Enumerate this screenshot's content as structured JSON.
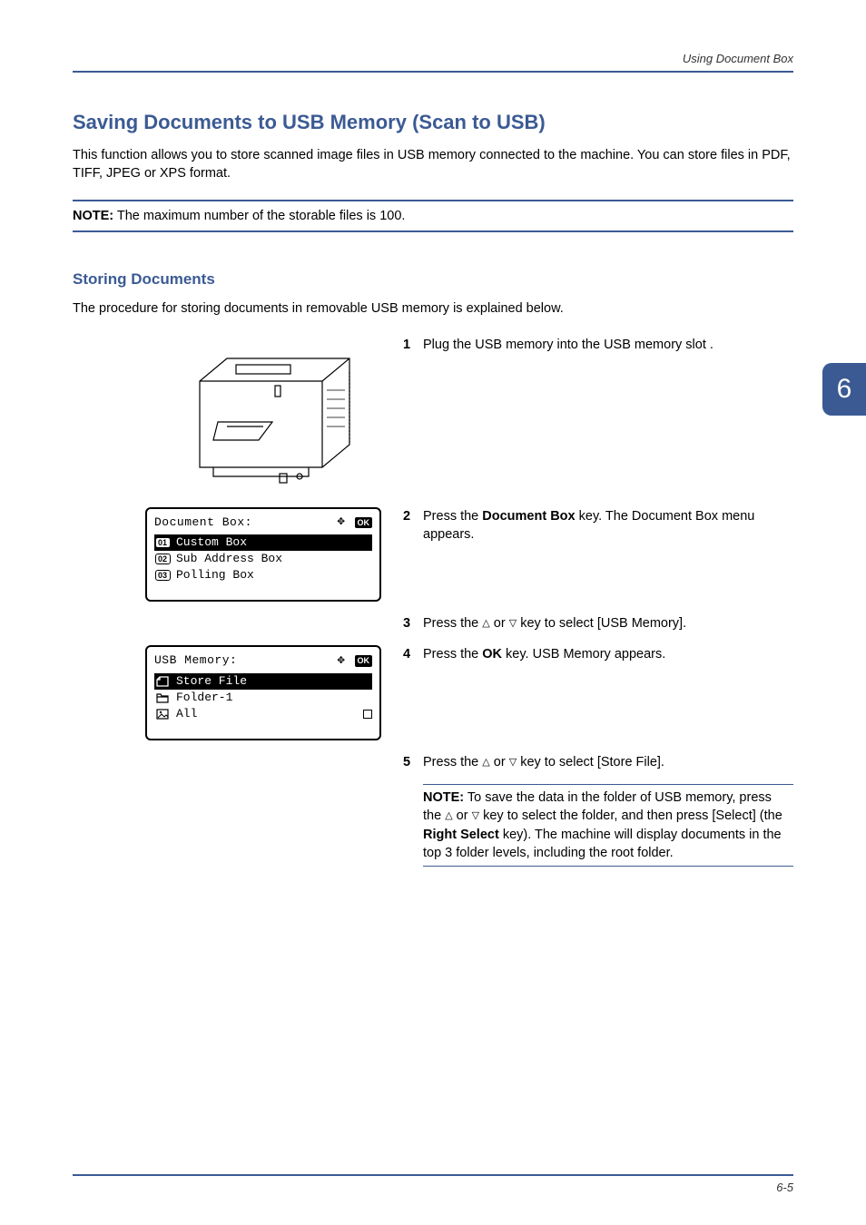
{
  "header": {
    "breadcrumb": "Using Document Box"
  },
  "title": "Saving Documents to USB Memory (Scan to USB)",
  "intro": "This function allows you to store scanned image files in USB memory connected to the machine. You can store files in PDF, TIFF, JPEG or XPS format.",
  "note": {
    "label": "NOTE:",
    "text": "The maximum number of the storable files is 100."
  },
  "subTitle": "Storing Documents",
  "procedureIntro": "The procedure for storing documents in removable USB memory is explained below.",
  "steps": {
    "s1": {
      "num": "1",
      "text": "Plug the USB memory into the USB memory slot ."
    },
    "s2": {
      "num": "2",
      "pre": "Press the ",
      "key": "Document Box",
      "post": " key. The Document Box menu appears."
    },
    "s3": {
      "num": "3",
      "pre": "Press the ",
      "post": " key to select [USB Memory]."
    },
    "s4": {
      "num": "4",
      "pre": "Press the ",
      "key": "OK",
      "post": " key. USB Memory appears."
    },
    "s5": {
      "num": "5",
      "pre": "Press the ",
      "post": " key to select [Store File]."
    }
  },
  "miniNote": {
    "label": "NOTE:",
    "line1a": "To save the data in the folder of USB memory, press the ",
    "line1b": " key to select the folder, and then press [Select] (the ",
    "key": "Right Select",
    "line1c": " key). The machine will display documents in the top 3 folder levels, including the root folder."
  },
  "lcd1": {
    "title": "Document Box:",
    "ok": "OK",
    "lines": [
      {
        "icon": "01",
        "text": "Custom Box",
        "selected": true
      },
      {
        "icon": "02",
        "text": "Sub Address Box",
        "selected": false
      },
      {
        "icon": "03",
        "text": "Polling Box",
        "selected": false
      }
    ]
  },
  "lcd2": {
    "title": "USB Memory:",
    "ok": "OK",
    "lines": [
      {
        "icon": "store",
        "text": "Store File",
        "selected": true,
        "end": false
      },
      {
        "icon": "folder",
        "text": "Folder-1",
        "selected": false,
        "end": false
      },
      {
        "icon": "image",
        "text": "All",
        "selected": false,
        "end": true
      }
    ]
  },
  "tab": "6",
  "footer": {
    "center": "",
    "page": "6-5"
  }
}
